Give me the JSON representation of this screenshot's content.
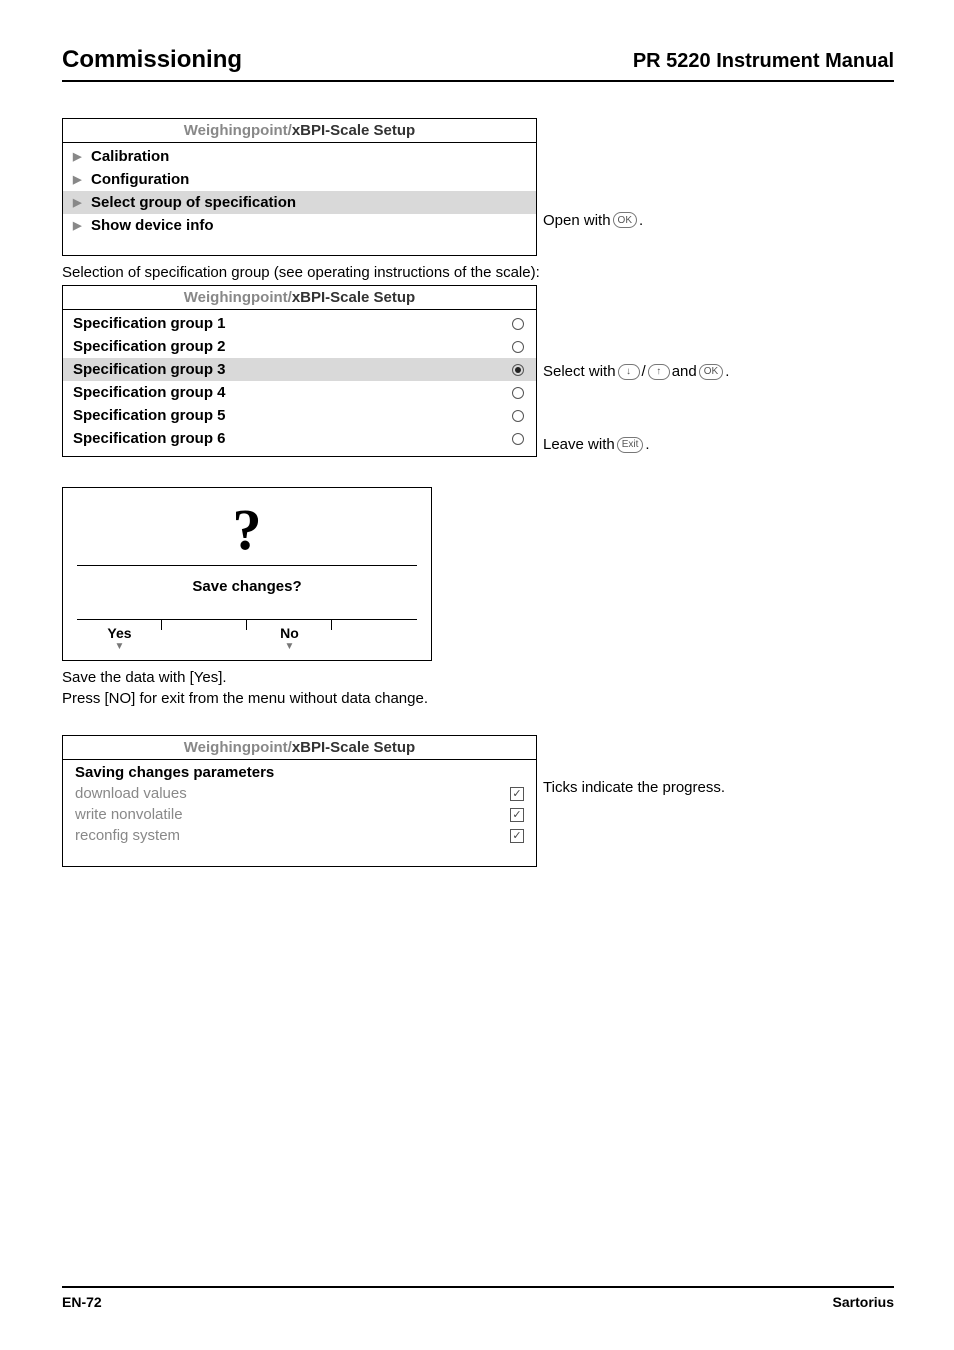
{
  "header": {
    "left": "Commissioning",
    "right": "PR 5220 Instrument Manual"
  },
  "panel1": {
    "title_prefix": "Weighingpoint/",
    "title_main": "xBPI-Scale Setup",
    "items": [
      {
        "label": "Calibration",
        "selected": false
      },
      {
        "label": "Configuration",
        "selected": false
      },
      {
        "label": "Select group of specification",
        "selected": true
      },
      {
        "label": "Show device info",
        "selected": false
      }
    ],
    "annot_open": {
      "prefix": "Open with ",
      "key": "OK",
      "suffix": "."
    }
  },
  "mid_text": "Selection of specification group (see operating instructions of the scale):",
  "panel2": {
    "title_prefix": "Weighingpoint/",
    "title_main": "xBPI-Scale Setup",
    "items": [
      {
        "label": "Specification group 1",
        "filled": false
      },
      {
        "label": "Specification group 2",
        "filled": false
      },
      {
        "label": "Specification group 3",
        "filled": true
      },
      {
        "label": "Specification group 4",
        "filled": false
      },
      {
        "label": "Specification group 5",
        "filled": false
      },
      {
        "label": "Specification group 6",
        "filled": false
      }
    ],
    "annot_select": {
      "prefix": "Select with ",
      "k1": "↓",
      "k2": "↑",
      "mid": " and ",
      "k3": "OK",
      "suffix": "."
    },
    "annot_leave": {
      "prefix": "Leave with ",
      "key": "Exit",
      "suffix": "."
    }
  },
  "dialog": {
    "mark": "?",
    "prompt": "Save changes?",
    "yes": "Yes",
    "no": "No"
  },
  "after_dialog_1": "Save the data with [Yes].",
  "after_dialog_2": "Press [NO] for exit from the menu without data change.",
  "panel3": {
    "title_prefix": "Weighingpoint/",
    "title_main": "xBPI-Scale Setup",
    "heading": "Saving changes parameters",
    "items": [
      {
        "label": "download values"
      },
      {
        "label": "write nonvolatile"
      },
      {
        "label": "reconfig system"
      }
    ],
    "annot": "Ticks indicate the progress."
  },
  "footer": {
    "left": "EN-72",
    "right": "Sartorius"
  }
}
